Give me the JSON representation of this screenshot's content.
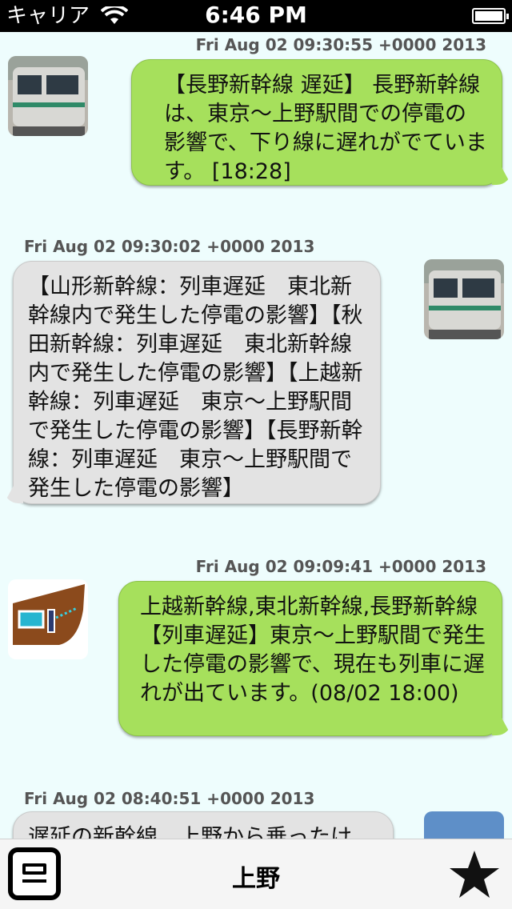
{
  "status_bar": {
    "carrier": "キャリア",
    "time": "6:46 PM"
  },
  "messages": [
    {
      "timestamp": "Fri Aug 02 09:30:55 +0000 2013",
      "text": "【長野新幹線 遅延】 長野新幹線は、東京〜上野駅間での停電の影響で、下り線に遅れがでています。 [18:28]",
      "side": "right"
    },
    {
      "timestamp": "Fri Aug 02 09:30:02 +0000 2013",
      "text": "【山形新幹線：列車遅延　東北新幹線内で発生した停電の影響】【秋田新幹線：列車遅延　東北新幹線内で発生した停電の影響】【上越新幹線：列車遅延　東京〜上野駅間で発生した停電の影響】【長野新幹線：列車遅延　東京〜上野駅間で発生した停電の影響】",
      "side": "left"
    },
    {
      "timestamp": "Fri Aug 02 09:09:41 +0000 2013",
      "text": "上越新幹線,東北新幹線,長野新幹線【列車遅延】東京〜上野駅間で発生した停電の影響で、現在も列車に遅れが出ています。(08/02 18:00)",
      "side": "right"
    },
    {
      "timestamp": "Fri Aug 02 08:40:51 +0000 2013",
      "text": "遅延の新幹線、上野から乗ったけ",
      "side": "left"
    }
  ],
  "bottom_bar": {
    "title": "上野"
  }
}
